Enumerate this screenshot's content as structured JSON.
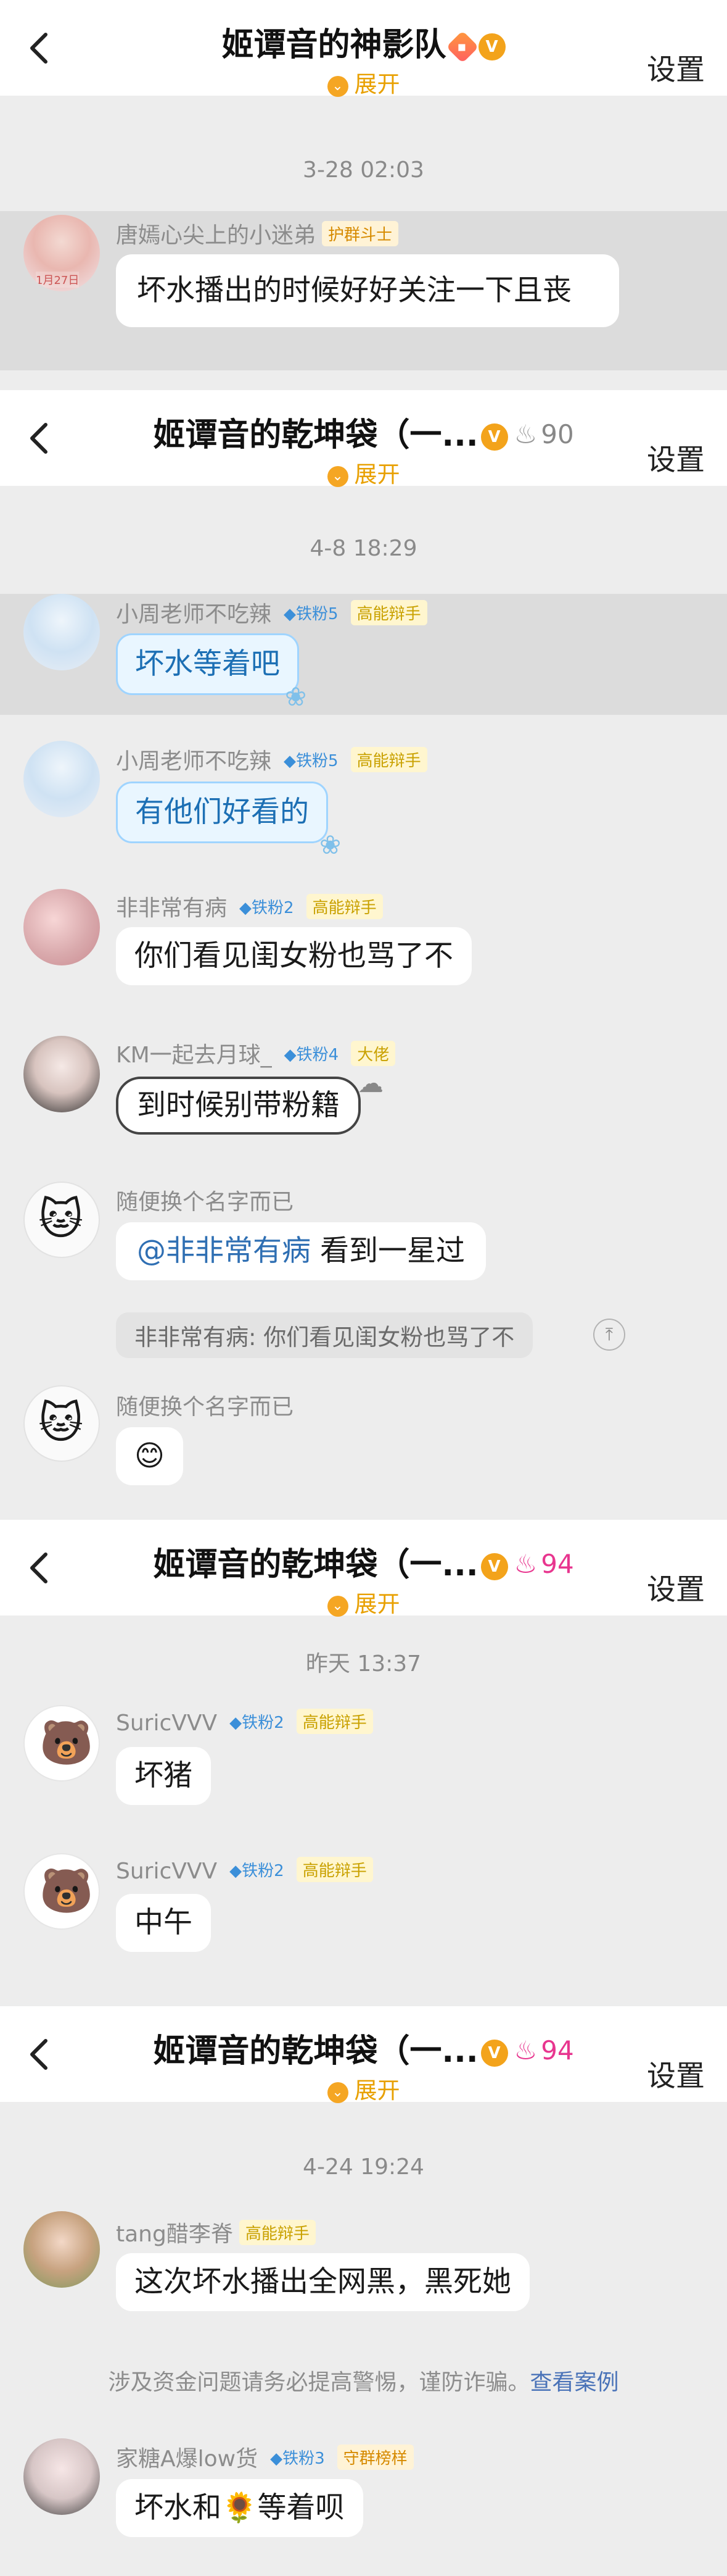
{
  "screens": [
    {
      "title": "姬谭音的神影队",
      "expand": "展开",
      "settings": "设置",
      "timestamp": "3-28 02:03",
      "messages": [
        {
          "name": "唐嫣心尖上的小迷弟",
          "role_tag": "护群斗士",
          "text": "坏水播出的时候好好关注一下且丧"
        }
      ]
    },
    {
      "title": "姬谭音的乾坤袋（一...",
      "level": "90",
      "expand": "展开",
      "settings": "设置",
      "timestamp": "4-8 18:29",
      "messages": [
        {
          "name": "小周老师不吃辣",
          "fan_tag": "铁粉5",
          "role_tag": "高能辩手",
          "text": "坏水等着吧"
        },
        {
          "name": "小周老师不吃辣",
          "fan_tag": "铁粉5",
          "role_tag": "高能辩手",
          "text": "有他们好看的"
        },
        {
          "name": "非非常有病",
          "fan_tag": "铁粉2",
          "role_tag": "高能辩手",
          "text": "你们看见闺女粉也骂了不"
        },
        {
          "name": "KM一起去月球_",
          "fan_tag": "铁粉4",
          "role_tag": "大佬",
          "text": "到时候别带粉籍"
        },
        {
          "name": "随便换个名字而已",
          "mention": "@非非常有病",
          "text": " 看到一星过",
          "quote": "非非常有病: 你们看见闺女粉也骂了不"
        },
        {
          "name": "随便换个名字而已",
          "text": "😊"
        }
      ]
    },
    {
      "title": "姬谭音的乾坤袋（一...",
      "level": "94",
      "expand": "展开",
      "settings": "设置",
      "timestamp": "昨天 13:37",
      "messages": [
        {
          "name": "SuricVVV",
          "fan_tag": "铁粉2",
          "role_tag": "高能辩手",
          "text": "坏猪"
        },
        {
          "name": "SuricVVV",
          "fan_tag": "铁粉2",
          "role_tag": "高能辩手",
          "text": "中午"
        }
      ]
    },
    {
      "title": "姬谭音的乾坤袋（一...",
      "level": "94",
      "expand": "展开",
      "settings": "设置",
      "timestamp": "4-24 19:24",
      "messages": [
        {
          "name": "tang醋李脊",
          "role_tag": "高能辩手",
          "text": "这次坏水播出全网黑，黑死她"
        },
        {
          "name": "家糖A爆low货",
          "fan_tag": "铁粉3",
          "role_tag": "守群榜样",
          "text": "坏水和🌻等着呗"
        }
      ],
      "notice": "涉及资金问题请务必提高警惕，谨防诈骗。",
      "notice_link": "查看案例"
    }
  ],
  "avatar_label": "1月27日",
  "icons": {
    "back": "chevron-left-icon",
    "expand": "chevron-down-icon",
    "fire": "fire-icon",
    "vip": "v-badge-icon",
    "quote": "quote-arrow-icon"
  },
  "colors": {
    "accent": "#f5a623",
    "level_gray": "#888888",
    "level_pink": "#e8368f",
    "fan_blue": "#3b8fd9"
  }
}
